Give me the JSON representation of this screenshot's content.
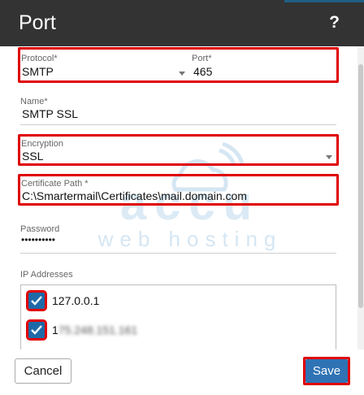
{
  "dialog": {
    "title": "Port",
    "help": "?"
  },
  "watermark": {
    "brand": "accu",
    "tagline": "web hosting"
  },
  "fields": {
    "protocol": {
      "label": "Protocol",
      "required": "*",
      "value": "SMTP"
    },
    "port": {
      "label": "Port",
      "required": "*",
      "value": "465"
    },
    "name": {
      "label": "Name",
      "required": "*",
      "value": "SMTP SSL"
    },
    "encryption": {
      "label": "Encryption",
      "value": "SSL"
    },
    "certificate_path": {
      "label": "Certificate Path",
      "required": "*",
      "value": "C:\\Smartermail\\Certificates\\mail.domain.com"
    },
    "password": {
      "label": "Password",
      "value": "••••••••••"
    }
  },
  "ip_addresses": {
    "label": "IP Addresses",
    "items": [
      {
        "value": "127.0.0.1",
        "checked": true
      },
      {
        "value": "1",
        "value_blurred": "75.248.151.161",
        "checked": true
      }
    ]
  },
  "footer": {
    "cancel_label": "Cancel",
    "save_label": "Save"
  },
  "colors": {
    "titlebar": "#333333",
    "highlight": "#e00000",
    "checkbox": "#1e6aa8",
    "save_button": "#2f73b5"
  }
}
